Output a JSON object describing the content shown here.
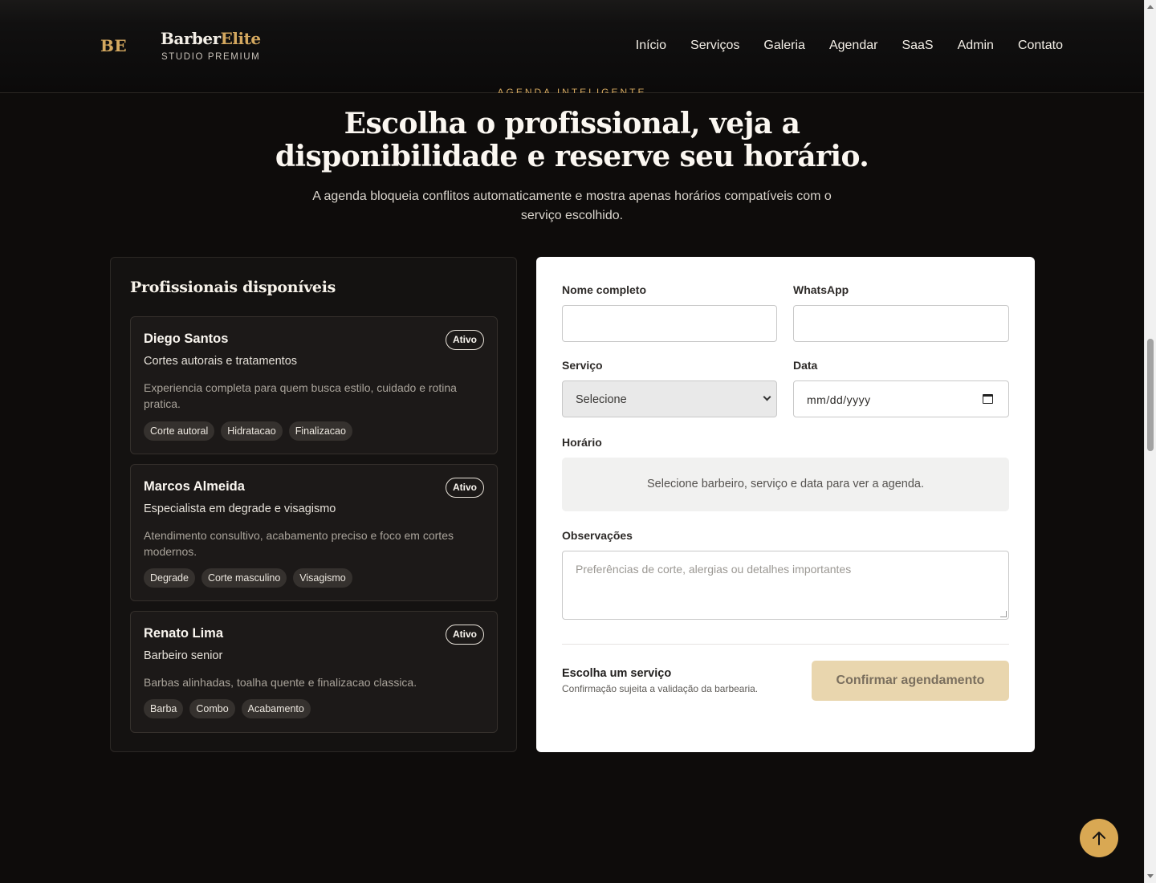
{
  "header": {
    "logo_mark": "BE",
    "brand_part1": "Barber",
    "brand_part2": "Elite",
    "tagline": "STUDIO PREMIUM",
    "nav": [
      "Início",
      "Serviços",
      "Galeria",
      "Agendar",
      "SaaS",
      "Admin",
      "Contato"
    ]
  },
  "hero": {
    "eyebrow": "AGENDA INTELIGENTE",
    "title": "Escolha o profissional, veja a disponibilidade e reserve seu horário.",
    "subtitle": "A agenda bloqueia conflitos automaticamente e mostra apenas horários compatíveis com o serviço escolhido."
  },
  "professionals": {
    "heading": "Profissionais disponíveis",
    "items": [
      {
        "name": "Diego Santos",
        "badge": "Ativo",
        "role": "Cortes autorais e tratamentos",
        "description": "Experiencia completa para quem busca estilo, cuidado e rotina pratica.",
        "tags": [
          "Corte autoral",
          "Hidratacao",
          "Finalizacao"
        ]
      },
      {
        "name": "Marcos Almeida",
        "badge": "Ativo",
        "role": "Especialista em degrade e visagismo",
        "description": "Atendimento consultivo, acabamento preciso e foco em cortes modernos.",
        "tags": [
          "Degrade",
          "Corte masculino",
          "Visagismo"
        ]
      },
      {
        "name": "Renato Lima",
        "badge": "Ativo",
        "role": "Barbeiro senior",
        "description": "Barbas alinhadas, toalha quente e finalizacao classica.",
        "tags": [
          "Barba",
          "Combo",
          "Acabamento"
        ]
      }
    ]
  },
  "form": {
    "name_label": "Nome completo",
    "name_value": "",
    "whatsapp_label": "WhatsApp",
    "whatsapp_value": "",
    "service_label": "Serviço",
    "service_value": "Selecione",
    "date_label": "Data",
    "date_value": "mm/dd/yyyy",
    "time_label": "Horário",
    "time_placeholder": "Selecione barbeiro, serviço e data para ver a agenda.",
    "notes_label": "Observações",
    "notes_placeholder": "Preferências de corte, alergias ou detalhes importantes",
    "summary_title": "Escolha um serviço",
    "summary_note": "Confirmação sujeita a validação da barbearia.",
    "confirm_label": "Confirmar agendamento"
  },
  "icons": {
    "back_to_top": "arrow-up-icon",
    "calendar": "calendar-icon"
  },
  "colors": {
    "accent": "#d4a85f",
    "background": "#0e0c0b",
    "button_disabled": "#e9d6ae"
  }
}
